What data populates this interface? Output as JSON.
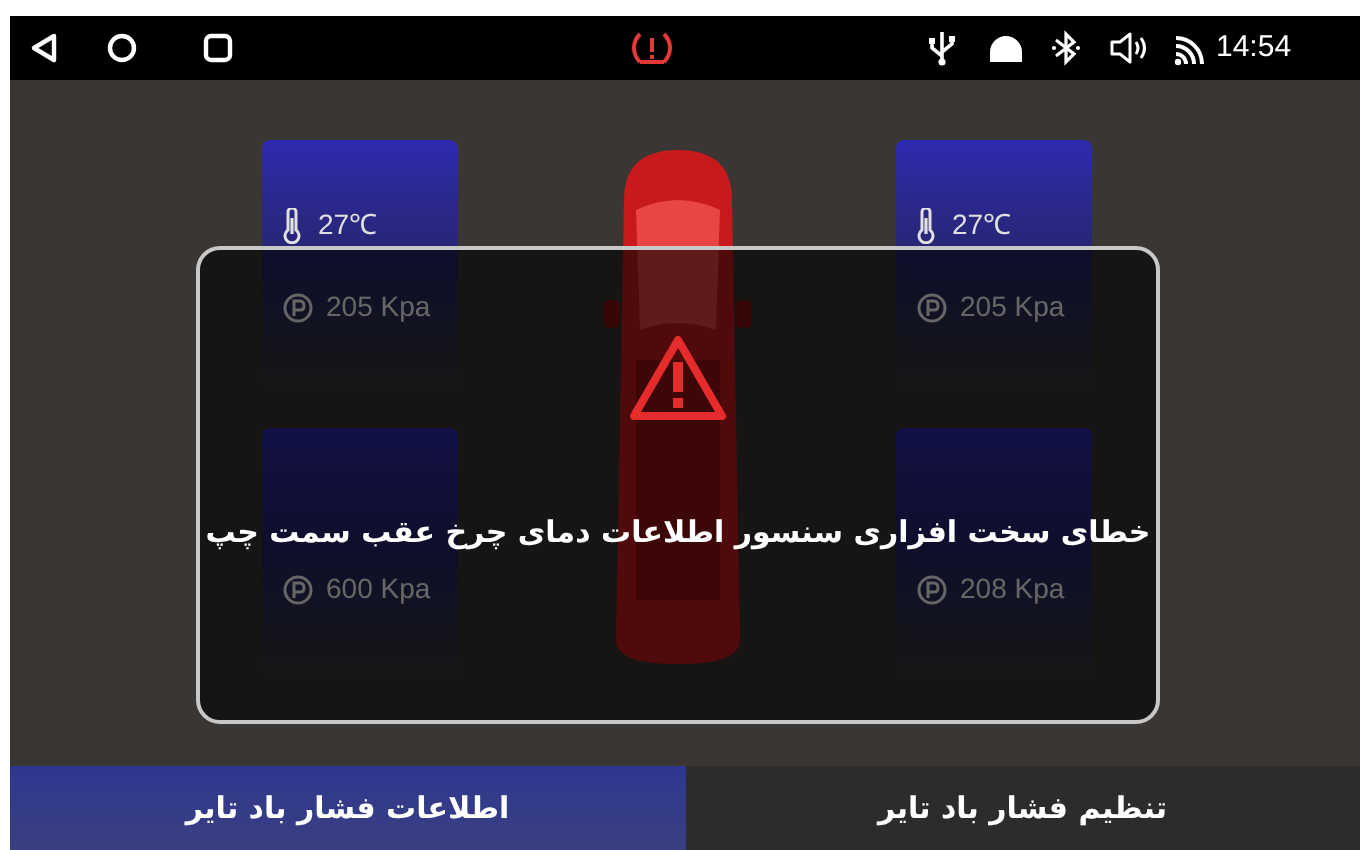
{
  "status_bar": {
    "time": "14:54"
  },
  "tires": [
    {
      "temperature": "27℃",
      "pressure": "205 Kpa"
    },
    {
      "temperature": "27℃",
      "pressure": "205 Kpa"
    },
    {
      "pressure": "600 Kpa"
    },
    {
      "pressure": "208 Kpa"
    }
  ],
  "dialog": {
    "message": "خطای سخت افزاری سنسور اطلاعات دمای چرخ عقب سمت چپ"
  },
  "tabs": [
    {
      "label": "تنظیم فشار باد تایر",
      "selected": false
    },
    {
      "label": "اطلاعات فشار باد تایر",
      "selected": true
    }
  ]
}
